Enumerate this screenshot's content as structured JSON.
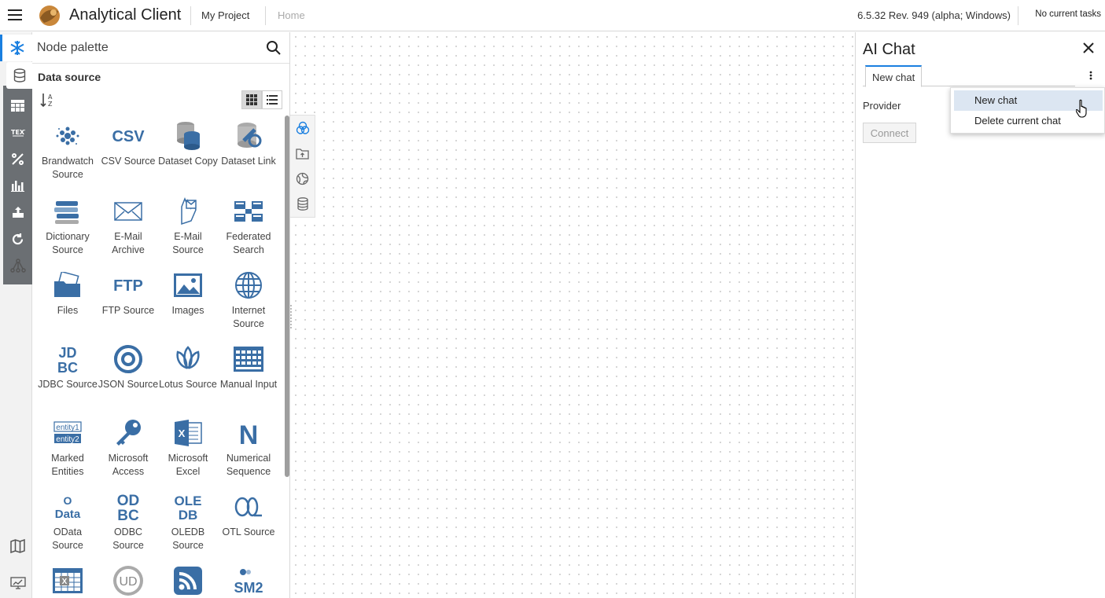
{
  "header": {
    "app_title": "Analytical Client",
    "project": "My Project",
    "home": "Home",
    "version": "6.5.32 Rev. 949 (alpha; Windows)",
    "tasks": "No current tasks"
  },
  "palette": {
    "search_placeholder": "Node palette",
    "section_title": "Data source",
    "nodes": [
      {
        "label": "Brandwatch Source",
        "icon": "brandwatch-icon"
      },
      {
        "label": "CSV Source",
        "icon": "csv-icon",
        "glyph": "CSV"
      },
      {
        "label": "Dataset Copy",
        "icon": "dataset-copy-icon"
      },
      {
        "label": "Dataset Link",
        "icon": "dataset-link-icon"
      },
      {
        "label": "Dictionary Source",
        "icon": "dictionary-icon"
      },
      {
        "label": "E-Mail Archive",
        "icon": "email-archive-icon"
      },
      {
        "label": "E-Mail Source",
        "icon": "email-source-icon"
      },
      {
        "label": "Federated Search",
        "icon": "federated-search-icon"
      },
      {
        "label": "Files",
        "icon": "files-icon"
      },
      {
        "label": "FTP Source",
        "icon": "ftp-icon",
        "glyph": "FTP"
      },
      {
        "label": "Images",
        "icon": "images-icon"
      },
      {
        "label": "Internet Source",
        "icon": "internet-icon"
      },
      {
        "label": "JDBC Source",
        "icon": "jdbc-icon",
        "glyph": "JD BC"
      },
      {
        "label": "JSON Source",
        "icon": "json-icon"
      },
      {
        "label": "Lotus Source",
        "icon": "lotus-icon"
      },
      {
        "label": "Manual Input",
        "icon": "manual-input-icon"
      },
      {
        "label": "Marked Entities",
        "icon": "marked-entities-icon",
        "glyph": "entity1 entity2"
      },
      {
        "label": "Microsoft Access",
        "icon": "access-key-icon"
      },
      {
        "label": "Microsoft Excel",
        "icon": "excel-icon"
      },
      {
        "label": "Numerical Sequence",
        "icon": "numerical-sequence-icon",
        "glyph": "N"
      },
      {
        "label": "OData Source",
        "icon": "odata-icon",
        "glyph": "O Data"
      },
      {
        "label": "ODBC Source",
        "icon": "odbc-icon",
        "glyph": "ODBC"
      },
      {
        "label": "OLEDB Source",
        "icon": "oledb-icon",
        "glyph": "OLE DB"
      },
      {
        "label": "OTL Source",
        "icon": "otl-icon"
      },
      {
        "label": "",
        "icon": "spreadsheet-icon"
      },
      {
        "label": "",
        "icon": "ud-icon",
        "glyph": "UD"
      },
      {
        "label": "",
        "icon": "rss-icon"
      },
      {
        "label": "",
        "icon": "sm2-icon",
        "glyph": "SM2"
      }
    ]
  },
  "chat": {
    "title": "AI Chat",
    "tab_label": "New chat",
    "provider_label": "Provider",
    "connect_label": "Connect",
    "menu": [
      {
        "label": "New chat",
        "hover": true
      },
      {
        "label": "Delete current chat",
        "hover": false
      }
    ]
  },
  "colors": {
    "accent": "#1a7fe0",
    "icon_blue": "#3a6ea5",
    "rail_dark": "#6b6f73"
  }
}
